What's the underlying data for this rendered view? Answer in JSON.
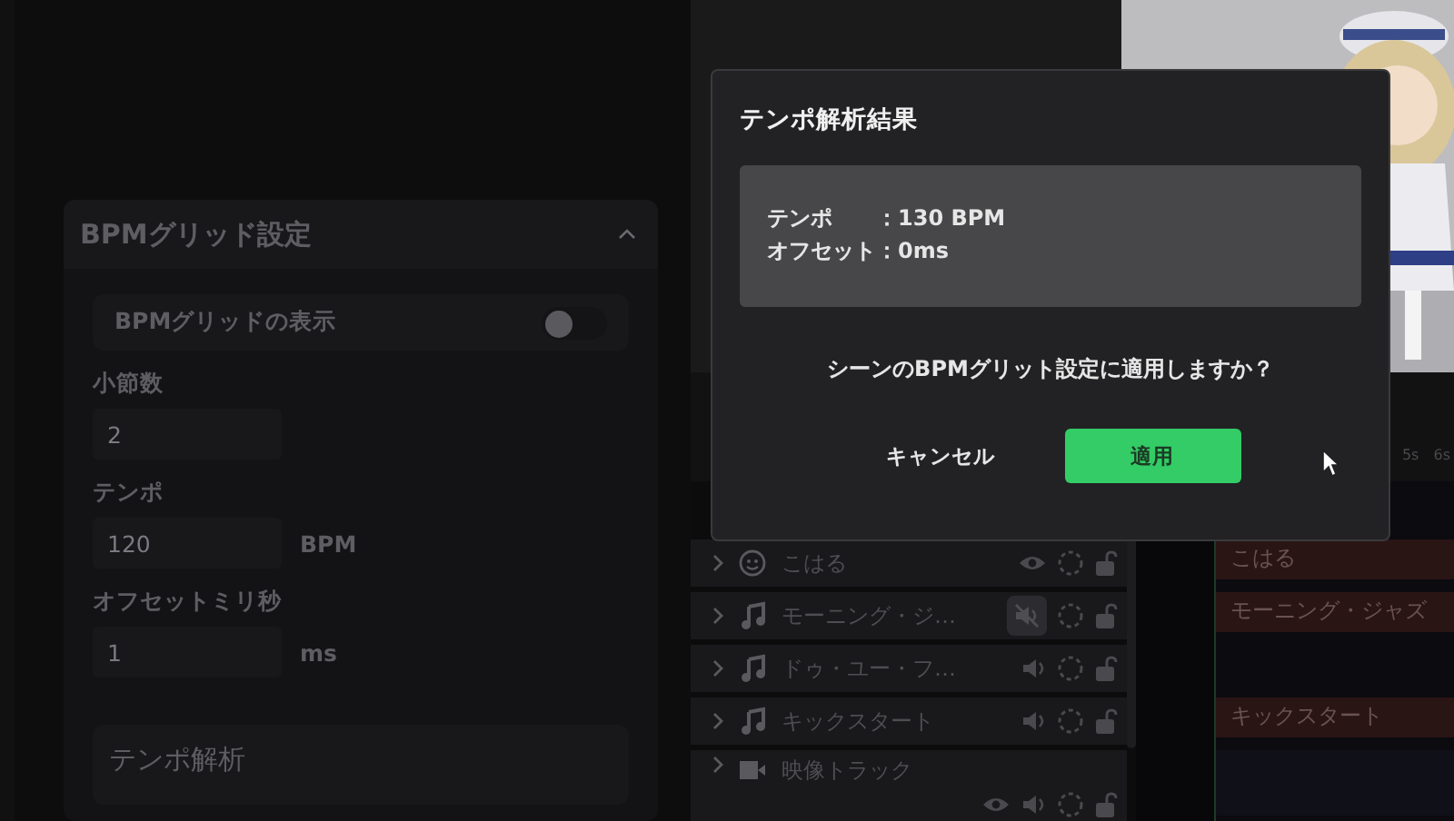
{
  "settings_panel": {
    "title": "BPMグリッド設定",
    "expanded": true,
    "grid_toggle": {
      "label": "BPMグリッドの表示",
      "on": false
    },
    "fields": [
      {
        "label": "小節数",
        "value": "2"
      },
      {
        "label": "テンポ",
        "value": "120",
        "unit": "BPM"
      },
      {
        "label": "オフセットミリ秒",
        "value": "1",
        "unit": "ms"
      }
    ],
    "analysis_section": {
      "title": "テンポ解析"
    }
  },
  "timeline": {
    "ruler_ticks": [
      "5s",
      "6s"
    ],
    "tracks": [
      {
        "kind": "character",
        "name": "こはる",
        "clip": "こはる"
      },
      {
        "kind": "audio",
        "name": "モーニング・ジ…",
        "muted": true,
        "clip": "モーニング・ジャズ"
      },
      {
        "kind": "audio",
        "name": "ドゥ・ユー・フ…",
        "muted": false
      },
      {
        "kind": "audio",
        "name": "キックスタート",
        "muted": false,
        "clip": "キックスタート"
      },
      {
        "kind": "video",
        "name": "映像トラック",
        "muted": false
      }
    ]
  },
  "dialog": {
    "title": "テンポ解析結果",
    "result": [
      {
        "label": "テンポ",
        "value": "：130 BPM"
      },
      {
        "label": "オフセット",
        "value": "：0ms"
      }
    ],
    "question": "シーンのBPMグリット設定に適用しますか？",
    "buttons": [
      {
        "label": "キャンセル",
        "kind": "text"
      },
      {
        "label": "適用",
        "kind": "primary"
      }
    ]
  }
}
